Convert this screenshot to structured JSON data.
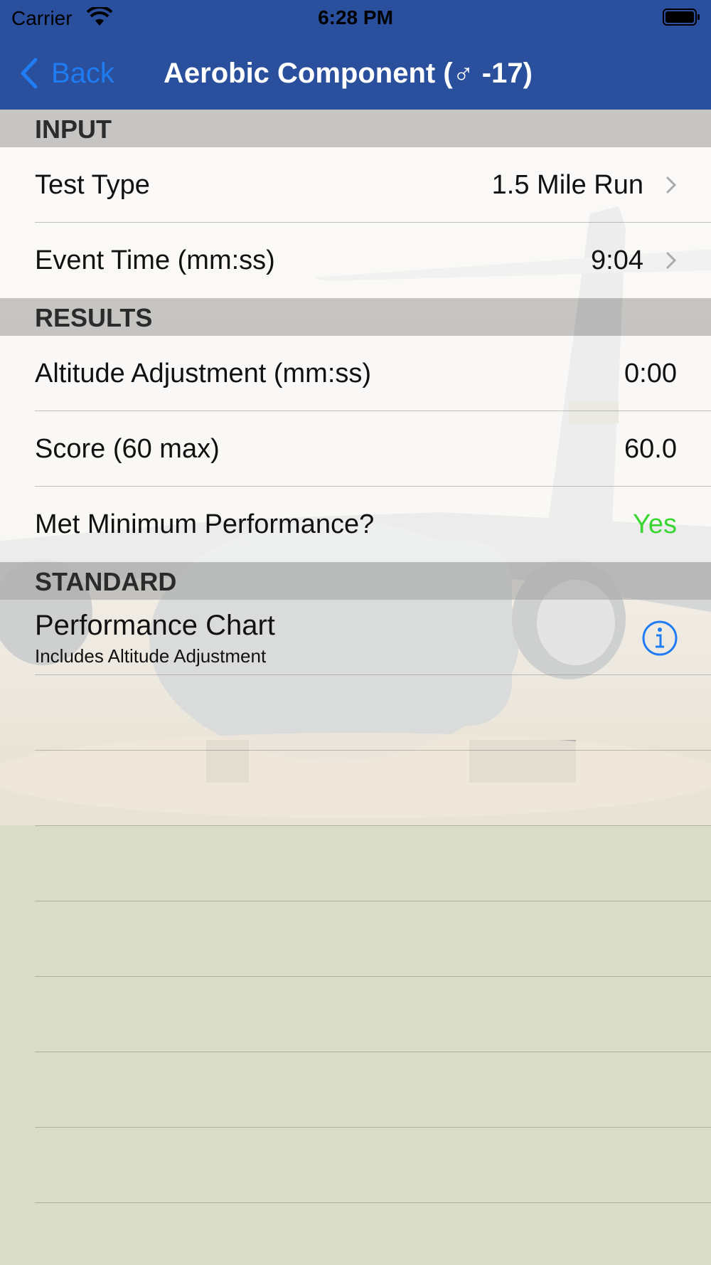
{
  "status_bar": {
    "carrier": "Carrier",
    "time": "6:28 PM"
  },
  "nav": {
    "back_label": "Back",
    "title": "Aerobic Component (♂  -17)"
  },
  "colors": {
    "nav_bar": "#2a4f9d",
    "accent": "#1f7cf2",
    "pass_green": "#39d631"
  },
  "sections": {
    "input": {
      "header": "INPUT",
      "rows": [
        {
          "label": "Test Type",
          "value": "1.5 Mile Run"
        },
        {
          "label": "Event Time (mm:ss)",
          "value": "9:04"
        }
      ]
    },
    "results": {
      "header": "RESULTS",
      "rows": [
        {
          "label": "Altitude Adjustment (mm:ss)",
          "value": "0:00"
        },
        {
          "label": "Score (60 max)",
          "value": "60.0"
        },
        {
          "label": "Met Minimum Performance?",
          "value": "Yes"
        }
      ]
    },
    "standard": {
      "header": "STANDARD",
      "chart": {
        "title": "Performance Chart",
        "subtitle": "Includes Altitude Adjustment"
      }
    }
  },
  "background_image": {
    "description_icon": "c17-aircraft-image"
  }
}
